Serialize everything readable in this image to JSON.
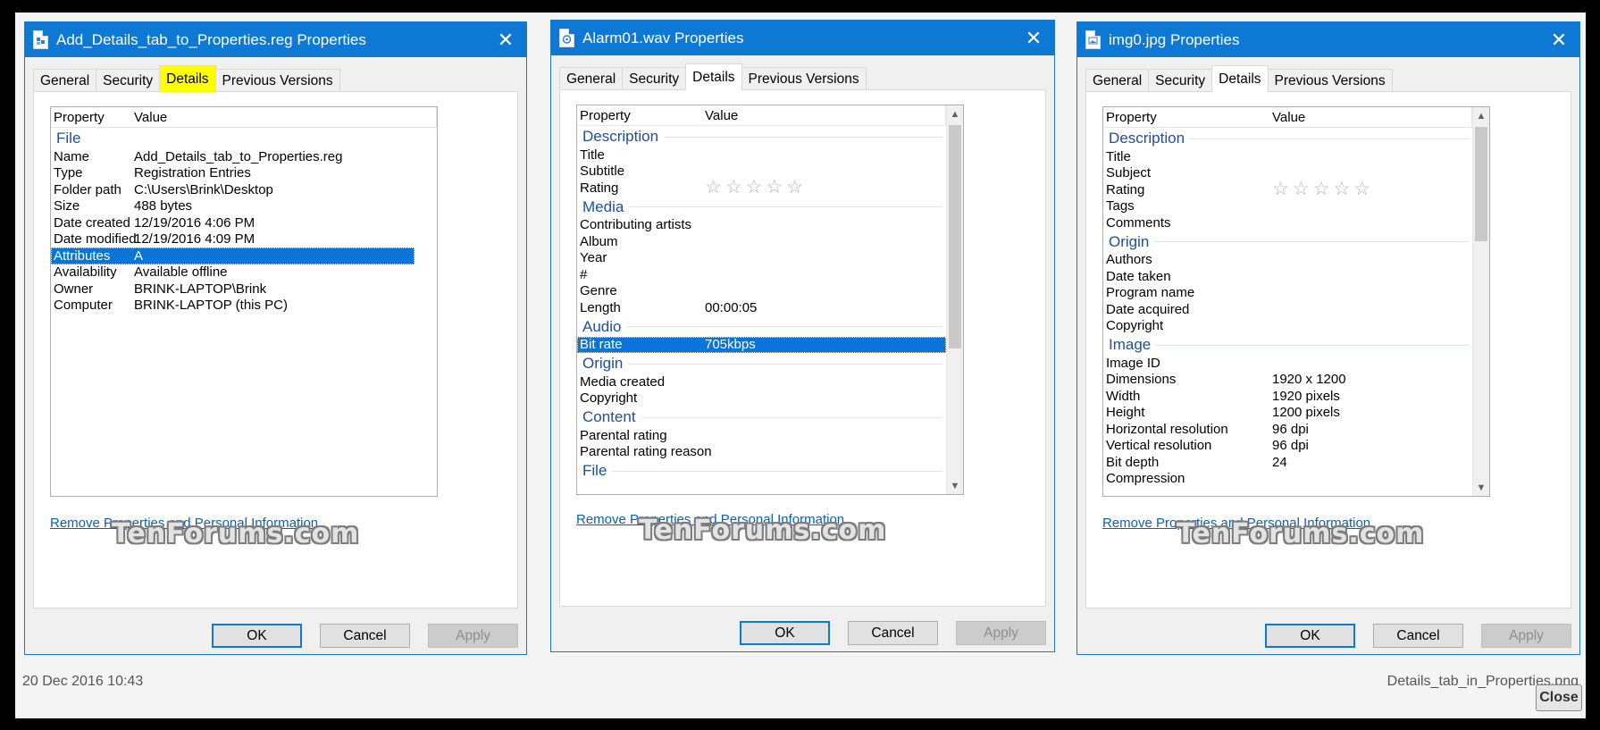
{
  "dialogs": [
    {
      "title": "Add_Details_tab_to_Properties.reg Properties",
      "icon": "reg-file-icon",
      "tabs": [
        "General",
        "Security",
        "Details",
        "Previous Versions"
      ],
      "active_tab": "Details",
      "header": {
        "property": "Property",
        "value": "Value"
      },
      "groups": [
        {
          "name": "File",
          "rows": [
            [
              "Name",
              "Add_Details_tab_to_Properties.reg"
            ],
            [
              "Type",
              "Registration Entries"
            ],
            [
              "Folder path",
              "C:\\Users\\Brink\\Desktop"
            ],
            [
              "Size",
              "488 bytes"
            ],
            [
              "Date created",
              "12/19/2016 4:06 PM"
            ],
            [
              "Date modified",
              "12/19/2016 4:09 PM"
            ],
            [
              "Attributes",
              "A"
            ],
            [
              "Availability",
              "Available offline"
            ],
            [
              "Owner",
              "BRINK-LAPTOP\\Brink"
            ],
            [
              "Computer",
              "BRINK-LAPTOP (this PC)"
            ]
          ]
        }
      ],
      "selected_row": "Attributes",
      "link": "Remove Properties and Personal Information",
      "buttons": {
        "ok": "OK",
        "cancel": "Cancel",
        "apply": "Apply"
      },
      "watermark": "TenForums.com"
    },
    {
      "title": "Alarm01.wav Properties",
      "icon": "audio-file-icon",
      "tabs": [
        "General",
        "Security",
        "Details",
        "Previous Versions"
      ],
      "active_tab": "Details",
      "header": {
        "property": "Property",
        "value": "Value"
      },
      "groups": [
        {
          "name": "Description",
          "rows": [
            [
              "Title",
              ""
            ],
            [
              "Subtitle",
              ""
            ],
            [
              "Rating",
              "☆☆☆☆☆"
            ]
          ]
        },
        {
          "name": "Media",
          "rows": [
            [
              "Contributing artists",
              ""
            ],
            [
              "Album",
              ""
            ],
            [
              "Year",
              ""
            ],
            [
              "#",
              ""
            ],
            [
              "Genre",
              ""
            ],
            [
              "Length",
              "00:00:05"
            ]
          ]
        },
        {
          "name": "Audio",
          "rows": [
            [
              "Bit rate",
              "705kbps"
            ]
          ]
        },
        {
          "name": "Origin",
          "rows": [
            [
              "Media created",
              ""
            ],
            [
              "Copyright",
              ""
            ]
          ]
        },
        {
          "name": "Content",
          "rows": [
            [
              "Parental rating",
              ""
            ],
            [
              "Parental rating reason",
              ""
            ]
          ]
        },
        {
          "name": "File",
          "rows": []
        }
      ],
      "selected_row": "Bit rate",
      "link": "Remove Properties and Personal Information",
      "buttons": {
        "ok": "OK",
        "cancel": "Cancel",
        "apply": "Apply"
      },
      "watermark": "TenForums.com"
    },
    {
      "title": "img0.jpg Properties",
      "icon": "image-file-icon",
      "tabs": [
        "General",
        "Security",
        "Details",
        "Previous Versions"
      ],
      "active_tab": "Details",
      "header": {
        "property": "Property",
        "value": "Value"
      },
      "groups": [
        {
          "name": "Description",
          "rows": [
            [
              "Title",
              ""
            ],
            [
              "Subject",
              ""
            ],
            [
              "Rating",
              "☆☆☆☆☆"
            ],
            [
              "Tags",
              ""
            ],
            [
              "Comments",
              ""
            ]
          ]
        },
        {
          "name": "Origin",
          "rows": [
            [
              "Authors",
              ""
            ],
            [
              "Date taken",
              ""
            ],
            [
              "Program name",
              ""
            ],
            [
              "Date acquired",
              ""
            ],
            [
              "Copyright",
              ""
            ]
          ]
        },
        {
          "name": "Image",
          "rows": [
            [
              "Image ID",
              ""
            ],
            [
              "Dimensions",
              "1920 x 1200"
            ],
            [
              "Width",
              "1920 pixels"
            ],
            [
              "Height",
              "1200 pixels"
            ],
            [
              "Horizontal resolution",
              "96 dpi"
            ],
            [
              "Vertical resolution",
              "96 dpi"
            ],
            [
              "Bit depth",
              "24"
            ],
            [
              "Compression",
              ""
            ]
          ]
        }
      ],
      "selected_row": "",
      "link": "Remove Properties and Personal Information",
      "buttons": {
        "ok": "OK",
        "cancel": "Cancel",
        "apply": "Apply"
      },
      "watermark": "TenForums.com"
    }
  ],
  "footer": {
    "date": "20 Dec 2016 10:43",
    "filename": "Details_tab_in_Properties.png",
    "close": "Close"
  },
  "colors": {
    "titlebar": "#0e78d5",
    "selection": "#0a74d8",
    "group_header": "#1e4fa0",
    "tab_highlight": "#ffff00"
  }
}
